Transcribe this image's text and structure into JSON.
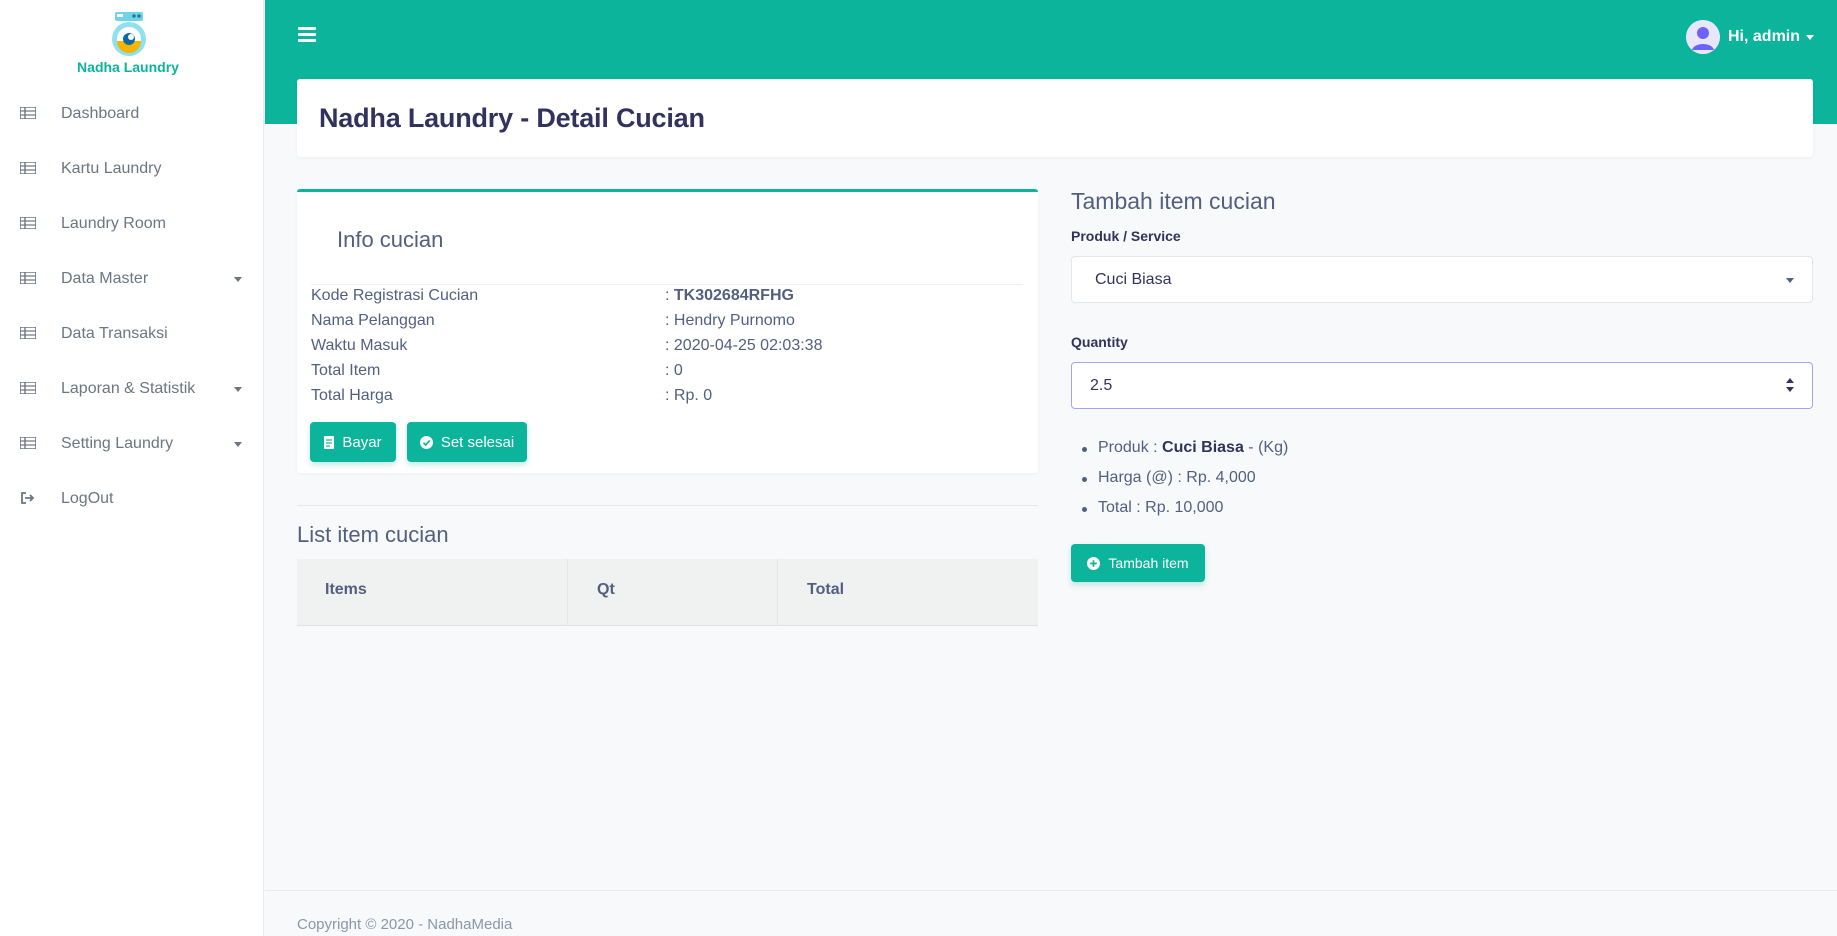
{
  "brand": {
    "name": "Nadha Laundry"
  },
  "sidebar": {
    "items": [
      {
        "label": "Dashboard",
        "has_caret": false
      },
      {
        "label": "Kartu Laundry",
        "has_caret": false
      },
      {
        "label": "Laundry Room",
        "has_caret": false
      },
      {
        "label": "Data Master",
        "has_caret": true
      },
      {
        "label": "Data Transaksi",
        "has_caret": false
      },
      {
        "label": "Laporan & Statistik",
        "has_caret": true
      },
      {
        "label": "Setting Laundry",
        "has_caret": true
      },
      {
        "label": "LogOut",
        "has_caret": false
      }
    ]
  },
  "topbar": {
    "user_greeting": "Hi, admin"
  },
  "header": {
    "title": "Nadha Laundry - Detail Cucian"
  },
  "info": {
    "title": "Info cucian",
    "rows": [
      {
        "key": "Kode Registrasi Cucian",
        "prefix": ": ",
        "value": "TK302684RFHG",
        "bold": true
      },
      {
        "key": "Nama Pelanggan",
        "prefix": ": ",
        "value": "Hendry Purnomo",
        "bold": false
      },
      {
        "key": "Waktu Masuk",
        "prefix": ": ",
        "value": "2020-04-25 02:03:38",
        "bold": false
      },
      {
        "key": "Total Item",
        "prefix": ": ",
        "value": "0",
        "bold": false
      },
      {
        "key": "Total Harga",
        "prefix": ": ",
        "value": "Rp. 0",
        "bold": false
      }
    ],
    "bayar_label": "Bayar",
    "selesai_label": "Set selesai"
  },
  "list": {
    "title": "List item cucian",
    "columns": [
      "Items",
      "Qt",
      "Total"
    ]
  },
  "form": {
    "title": "Tambah item cucian",
    "produk_label": "Produk / Service",
    "produk_value": "Cuci Biasa",
    "quantity_label": "Quantity",
    "quantity_value": "2.5",
    "summary": {
      "produk_prefix": "Produk : ",
      "produk_name": "Cuci Biasa",
      "produk_unit": " - (Kg)",
      "harga": "Harga (@) : Rp. 4,000",
      "total": "Total : Rp. 10,000"
    },
    "add_label": "Tambah item"
  },
  "footer": {
    "text": "Copyright © 2020 - NadhaMedia"
  },
  "colors": {
    "primary": "#0bb49b",
    "text": "#525f7f",
    "heading": "#32325d"
  },
  "icons": {
    "nav": "list-icon",
    "logout": "sign-out-icon",
    "bayar": "receipt-icon",
    "selesai": "check-circle-icon",
    "add": "plus-circle-icon"
  }
}
